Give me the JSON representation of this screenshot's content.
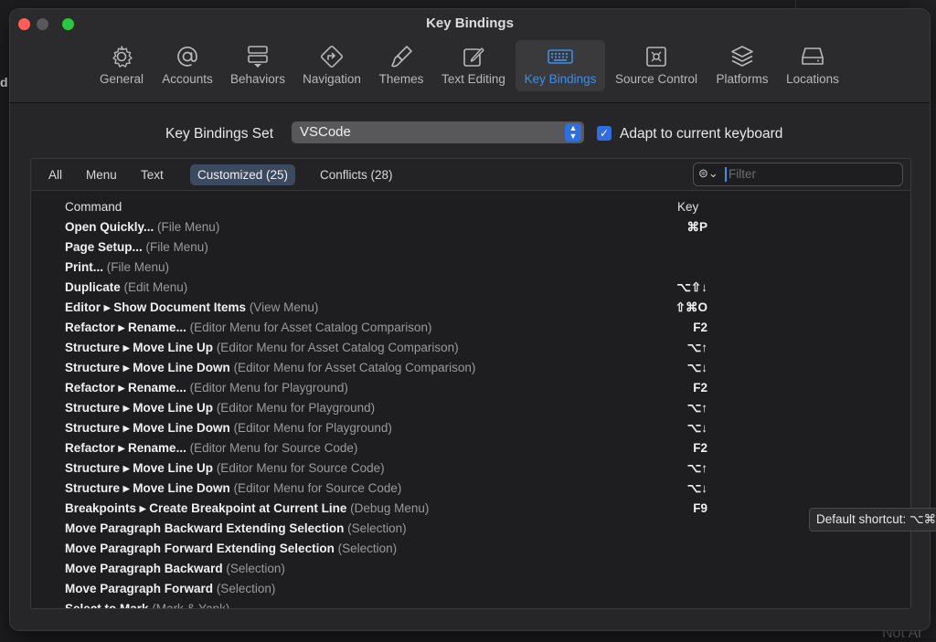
{
  "window": {
    "title": "Key Bindings"
  },
  "background": {
    "left_letter": "d",
    "bottom_text": "Not Ar"
  },
  "toolbar": {
    "tabs": [
      {
        "label": "General",
        "icon": "gear-icon"
      },
      {
        "label": "Accounts",
        "icon": "at-icon"
      },
      {
        "label": "Behaviors",
        "icon": "behaviors-icon"
      },
      {
        "label": "Navigation",
        "icon": "navigation-icon"
      },
      {
        "label": "Themes",
        "icon": "brush-icon"
      },
      {
        "label": "Text Editing",
        "icon": "pencil-icon"
      },
      {
        "label": "Key Bindings",
        "icon": "keyboard-icon"
      },
      {
        "label": "Source Control",
        "icon": "source-control-icon"
      },
      {
        "label": "Platforms",
        "icon": "layers-icon"
      },
      {
        "label": "Locations",
        "icon": "drive-icon"
      }
    ],
    "active_tab": "Key Bindings"
  },
  "key_bindings_set": {
    "label": "Key Bindings Set",
    "value": "VSCode",
    "adapt_checked": true,
    "adapt_label": "Adapt to current keyboard"
  },
  "filters": {
    "segments": [
      "All",
      "Menu",
      "Text",
      "Customized (25)",
      "Conflicts (28)"
    ],
    "active_segment": "Customized (25)",
    "search_placeholder": "Filter"
  },
  "table": {
    "columns": [
      "Command",
      "Key"
    ],
    "rows": [
      {
        "command": "Open Quickly...",
        "context": "(File Menu)",
        "key": "⌘P"
      },
      {
        "command": "Page Setup...",
        "context": "(File Menu)",
        "key": ""
      },
      {
        "command": "Print...",
        "context": "(File Menu)",
        "key": ""
      },
      {
        "command": "Duplicate",
        "context": "(Edit Menu)",
        "key": "⌥⇧↓"
      },
      {
        "command": "Editor ▸ Show Document Items",
        "context": "(View Menu)",
        "key": "⇧⌘O"
      },
      {
        "command": "Refactor ▸ Rename...",
        "context": "(Editor Menu for Asset Catalog Comparison)",
        "key": "F2"
      },
      {
        "command": "Structure ▸ Move Line Up",
        "context": "(Editor Menu for Asset Catalog Comparison)",
        "key": "⌥↑"
      },
      {
        "command": "Structure ▸ Move Line Down",
        "context": "(Editor Menu for Asset Catalog Comparison)",
        "key": "⌥↓"
      },
      {
        "command": "Refactor ▸ Rename...",
        "context": "(Editor Menu for Playground)",
        "key": "F2"
      },
      {
        "command": "Structure ▸ Move Line Up",
        "context": "(Editor Menu for Playground)",
        "key": "⌥↑"
      },
      {
        "command": "Structure ▸ Move Line Down",
        "context": "(Editor Menu for Playground)",
        "key": "⌥↓"
      },
      {
        "command": "Refactor ▸ Rename...",
        "context": "(Editor Menu for Source Code)",
        "key": "F2"
      },
      {
        "command": "Structure ▸ Move Line Up",
        "context": "(Editor Menu for Source Code)",
        "key": "⌥↑"
      },
      {
        "command": "Structure ▸ Move Line Down",
        "context": "(Editor Menu for Source Code)",
        "key": "⌥↓"
      },
      {
        "command": "Breakpoints ▸ Create Breakpoint at Current Line",
        "context": "(Debug Menu)",
        "key": "F9"
      },
      {
        "command": "Move Paragraph Backward Extending Selection",
        "context": "(Selection)",
        "key": ""
      },
      {
        "command": "Move Paragraph Forward Extending Selection",
        "context": "(Selection)",
        "key": ""
      },
      {
        "command": "Move Paragraph Backward",
        "context": "(Selection)",
        "key": ""
      },
      {
        "command": "Move Paragraph Forward",
        "context": "(Selection)",
        "key": ""
      },
      {
        "command": "Select to Mark",
        "context": "(Mark & Yank)",
        "key": ""
      }
    ]
  },
  "tooltip": {
    "text": "Default shortcut: ⌥⌘"
  },
  "colors": {
    "accent": "#3b8eea",
    "checkbox": "#2f6ee0",
    "window_bg": "#272729"
  }
}
